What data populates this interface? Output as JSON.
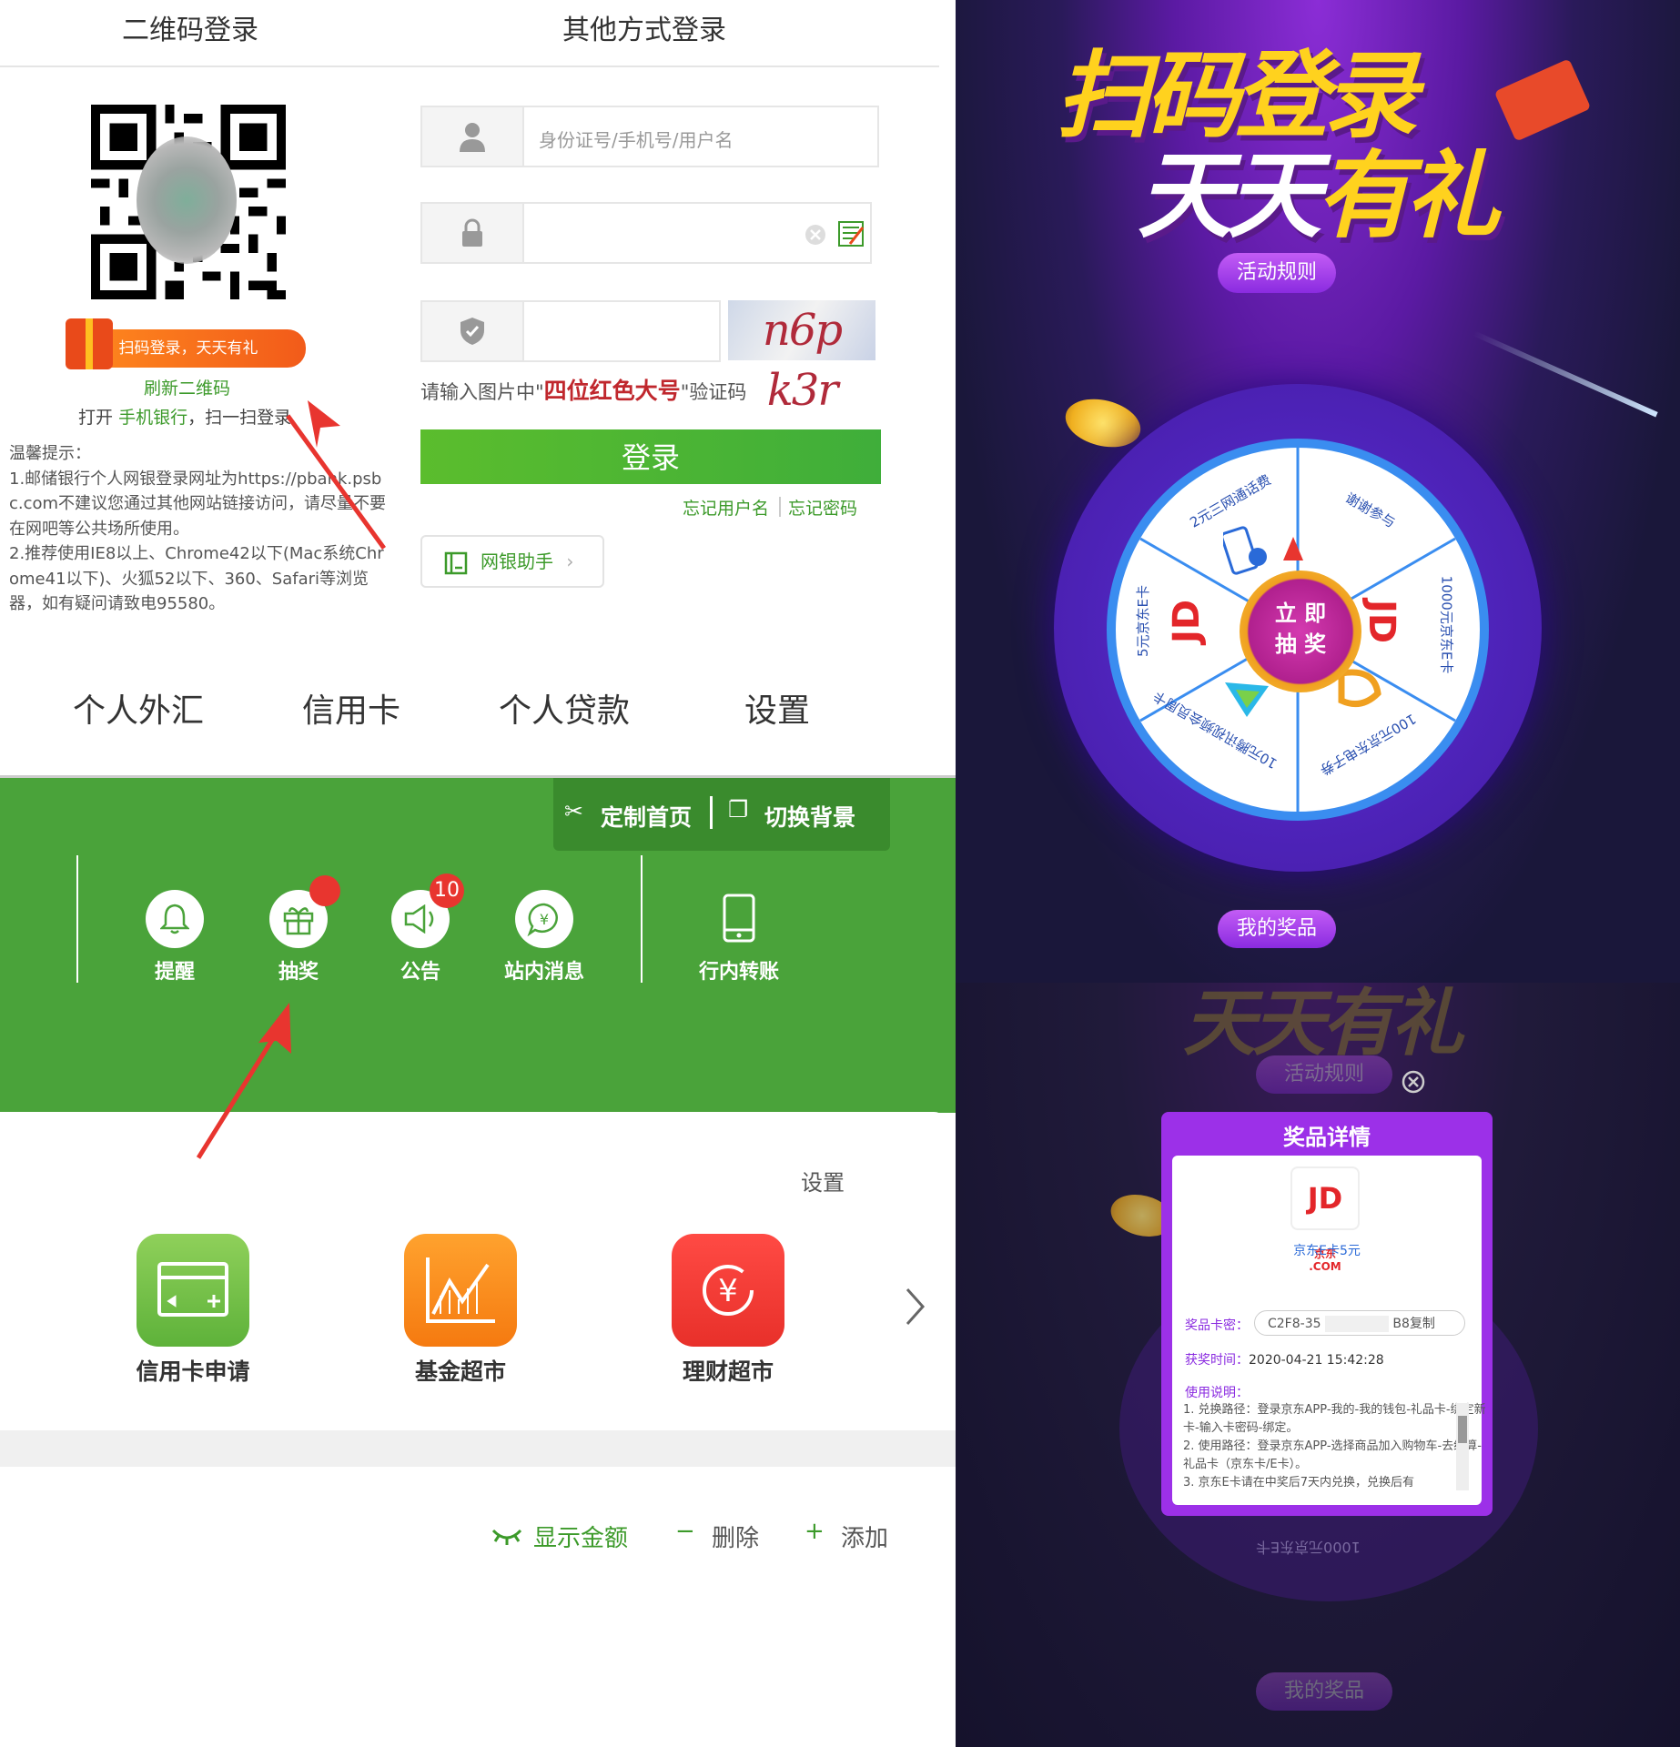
{
  "login": {
    "tab_qr": "二维码登录",
    "tab_other": "其他方式登录",
    "qr_banner": "扫码登录，天天有礼",
    "refresh_qr": "刷新二维码",
    "scan_prefix": "打开",
    "scan_app": "手机银行",
    "scan_suffix": "，扫一扫登录",
    "notice_title": "温馨提示：",
    "notice_1": "1.邮储银行个人网银登录网址为https://pbank.psbc.com不建议您通过其他网站链接访问，请尽量不要在网吧等公共场所使用。",
    "notice_2": "2.推荐使用IE8以上、Chrome42以下(Mac系统Chrome41以下)、火狐52以下、360、Safari等浏览器，如有疑问请致电95580。",
    "username_placeholder": "身份证号/手机号/用户名",
    "captcha_text": "n6p k3r",
    "captcha_tip_prefix": "请输入图片中\"",
    "captcha_tip_highlight": "四位红色大号",
    "captcha_tip_suffix": "\"验证码",
    "login_button": "登录",
    "forgot_username": "忘记用户名",
    "forgot_password": "忘记密码",
    "assistant": "网银助手"
  },
  "nav": [
    "个人外汇",
    "信用卡",
    "个人贷款",
    "设置"
  ],
  "toolbar": {
    "customize": "定制首页",
    "switch_bg": "切换背景"
  },
  "quick": [
    {
      "label": "提醒",
      "badge": ""
    },
    {
      "label": "抽奖",
      "badge": ""
    },
    {
      "label": "公告",
      "badge": "10"
    },
    {
      "label": "站内消息",
      "badge": ""
    },
    {
      "label": "行内转账",
      "badge": ""
    }
  ],
  "services": {
    "settings": "设置",
    "items": [
      "信用卡申请",
      "基金超市",
      "理财超市"
    ]
  },
  "account": {
    "show_amount": "显示金额",
    "delete": "删除",
    "add": "添加"
  },
  "promo": {
    "title_line1": "扫码登录",
    "title_line2a": "天天",
    "title_line2b": "有礼",
    "rules": "活动规则",
    "my_prizes": "我的奖品",
    "spin": "立即抽奖",
    "spin_line1": "立 即",
    "spin_line2": "抽 奖",
    "segments": [
      "2元三网通话费",
      "谢谢参与",
      "1000元京东E卡",
      "100元京东电子券",
      "10元腾讯视频会员周卡",
      "5元京东E卡"
    ],
    "jd_mark": "JD",
    "jd_cn": "京东",
    "jd_com": ".COM"
  },
  "prize_modal": {
    "title": "奖品详情",
    "bg_title": "天天有礼",
    "prize_name": "京东E卡5元",
    "card_label": "奖品卡密：",
    "card_value": "C2F8-35",
    "card_tail": "B8",
    "copy": "复制",
    "time_label": "获奖时间：",
    "time_value": "2020-04-21 15:42:28",
    "usage_label": "使用说明：",
    "usage_1": "1. 兑换路径：登录京东APP-我的-我的钱包-礼品卡-绑定新卡-输入卡密码-绑定。",
    "usage_2": "2. 使用路径：登录京东APP-选择商品加入购物车-去结算-礼品卡（京东卡/E卡）。",
    "usage_3": "3. 京东E卡请在中奖后7天内兑换，兑换后有",
    "bg_rules": "活动规则",
    "bg_prizes": "我的奖品",
    "bg_segment": "1000元京东E卡"
  },
  "colors": {
    "green": "#4aa33a",
    "login_green": "#5bbd2d",
    "purple": "#9c30e8",
    "red": "#e8352f",
    "orange": "#ff8a1e"
  }
}
